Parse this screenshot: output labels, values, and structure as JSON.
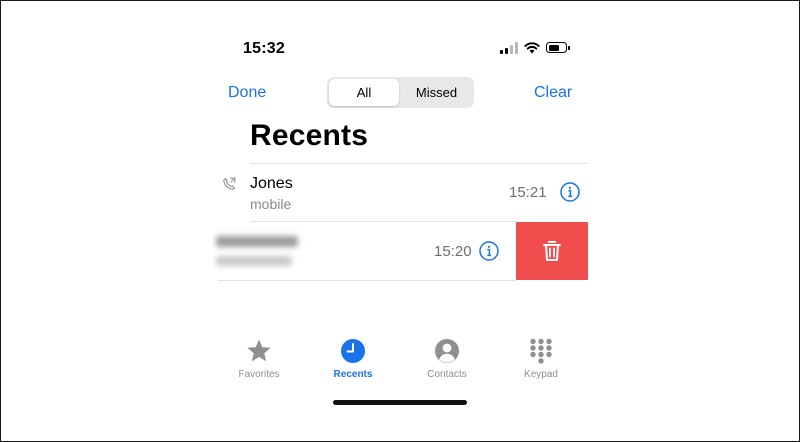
{
  "status_bar": {
    "time": "15:32",
    "signal_icon": "cellular-signal-icon",
    "wifi_icon": "wifi-icon",
    "battery_icon": "battery-icon"
  },
  "nav": {
    "done_label": "Done",
    "clear_label": "Clear",
    "segments": [
      {
        "label": "All",
        "selected": true
      },
      {
        "label": "Missed",
        "selected": false
      }
    ]
  },
  "page_title": "Recents",
  "calls": [
    {
      "name": "Jones",
      "type": "mobile",
      "time": "15:21",
      "outgoing_icon": "outgoing-call-icon",
      "info_icon": "info-icon"
    },
    {
      "name": "",
      "type": "",
      "time": "15:20",
      "info_icon": "info-icon",
      "name_blurred": true,
      "swiped": true,
      "delete_icon": "trash-icon"
    }
  ],
  "colors": {
    "accent": "#1a73e8",
    "delete": "#f24d4d",
    "inactive_tab": "#8e8e93"
  },
  "tabs": [
    {
      "label": "Favorites",
      "icon": "star-icon",
      "active": false
    },
    {
      "label": "Recents",
      "icon": "clock-icon",
      "active": true
    },
    {
      "label": "Contacts",
      "icon": "person-circle-icon",
      "active": false
    },
    {
      "label": "Keypad",
      "icon": "keypad-icon",
      "active": false
    }
  ]
}
